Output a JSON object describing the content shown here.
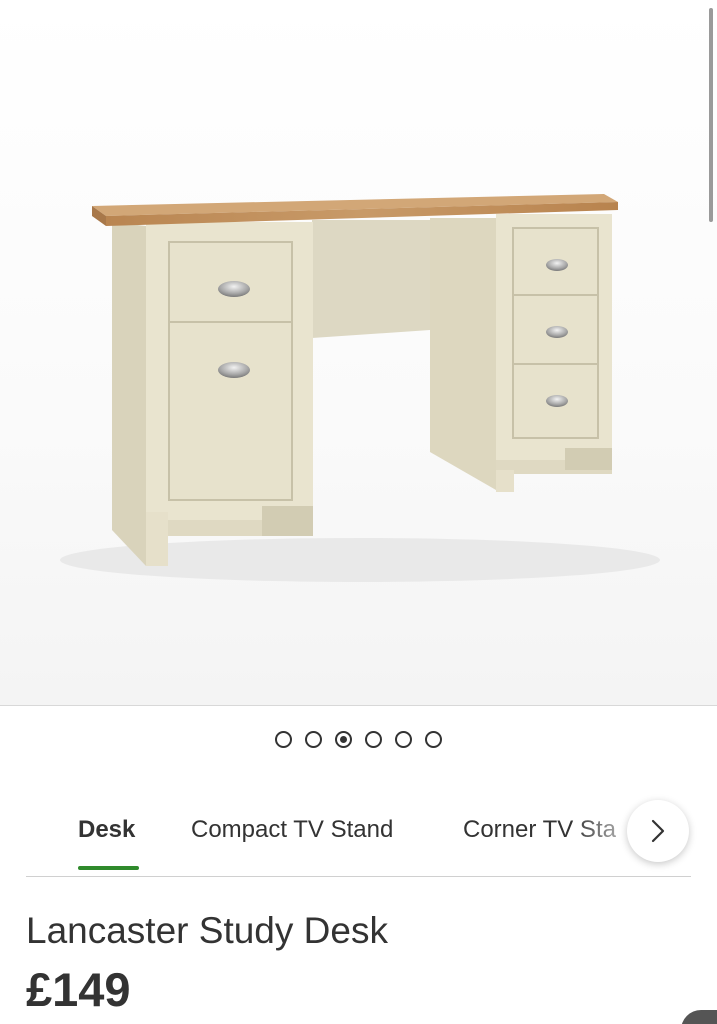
{
  "gallery": {
    "image_alt": "Lancaster Study Desk product image",
    "dots_count": 6,
    "active_dot_index": 2
  },
  "tabs": {
    "items": [
      {
        "label": "Desk",
        "active": true
      },
      {
        "label": "Compact TV Stand",
        "active": false
      },
      {
        "label": "Corner TV Sta",
        "active": false
      }
    ],
    "accent_color": "#2f8a2c",
    "next_icon": "chevron-right-icon"
  },
  "product": {
    "title": "Lancaster Study Desk",
    "price": "£149"
  }
}
